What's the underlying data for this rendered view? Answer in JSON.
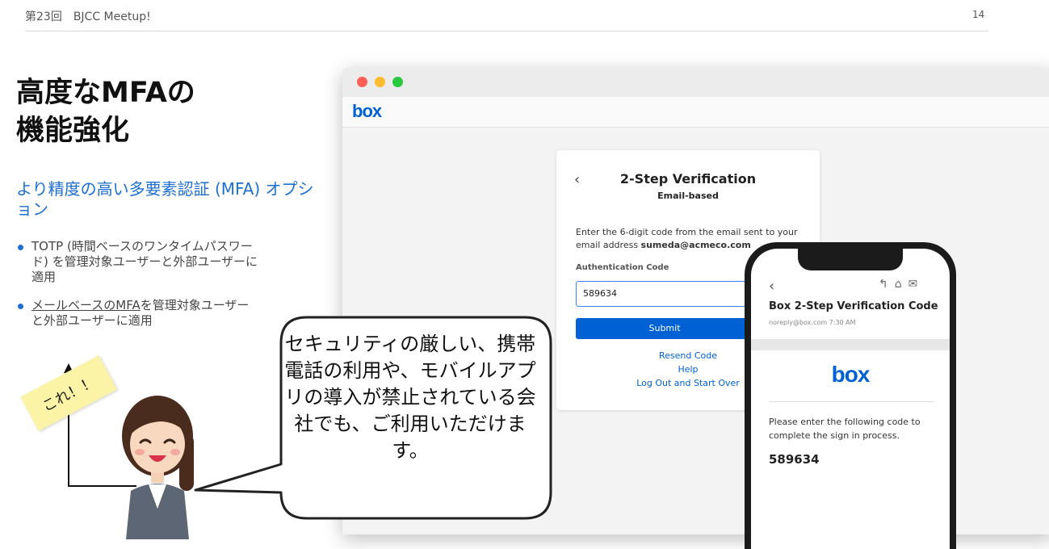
{
  "slide": {
    "header_left": "第23回　BJCC Meetup!",
    "page_number": "14",
    "title_line1": "高度なMFAの",
    "title_line2": "機能強化",
    "subtitle": "より精度の高い多要素認証 (MFA) オプション",
    "bullet1": "TOTP (時間ベースのワンタイムパスワード) を管理対象ユーザーと外部ユーザーに適用",
    "bullet2_underlined": "メールベースのMFA",
    "bullet2_rest": "を管理対象ユーザーと外部ユーザーに適用",
    "sticky_note": "これ！！",
    "speech_bubble": "セキュリティの厳しい、携帯電話の利用や、モバイルアプリの導入が禁止されている会社でも、ご利用いただけます。"
  },
  "browser": {
    "logo": "box",
    "traffic_light_colors": [
      "#ff5f57",
      "#febc2e",
      "#28c840"
    ]
  },
  "verification_card": {
    "back_icon": "chevron-left-icon",
    "title": "2-Step Verification",
    "subtitle": "Email-based",
    "description_prefix": "Enter the 6-digit code from the email sent to your email address ",
    "email": "sumeda@acmeco.com",
    "code_label": "Authentication Code",
    "code_value": "589634",
    "submit_label": "Submit",
    "resend_label": "Resend Code",
    "help_label": "Help",
    "logout_label": "Log Out and Start Over"
  },
  "phone_email": {
    "subject": "Box 2-Step Verification Code",
    "from": "noreply@box.com",
    "time": "7:30 AM",
    "logo": "box",
    "message": "Please enter the following code to complete the sign in process.",
    "code": "589634",
    "toolbar_icons": [
      "reply-icon",
      "trash-icon",
      "mail-icon"
    ]
  },
  "colors": {
    "accent": "#1d6fd1",
    "box_blue": "#0061d5"
  }
}
